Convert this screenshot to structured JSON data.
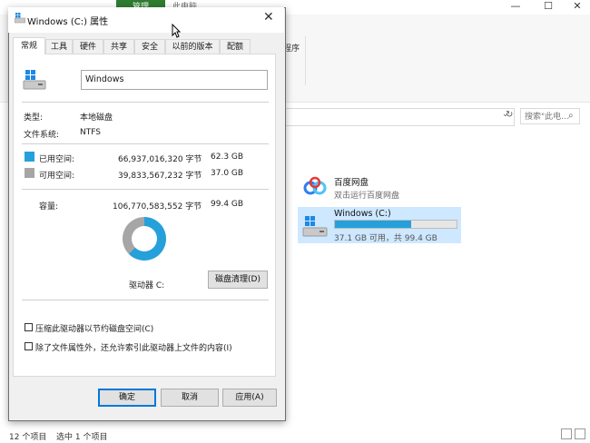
{
  "explorer": {
    "ribbon": {
      "manage_tab": "管理",
      "this_pc_tab": "此电脑",
      "group_label": "程序"
    },
    "search_placeholder": "搜索\"此电...",
    "items": [
      {
        "title": "百度网盘",
        "subtitle": "双击运行百度网盘"
      },
      {
        "title": "Windows (C:)",
        "free_text": "37.1 GB 可用，共 99.4 GB",
        "usage_fraction": 0.627
      }
    ],
    "status": {
      "count": "12 个项目",
      "selected": "选中 1 个项目"
    }
  },
  "dialog": {
    "title": "Windows (C:) 属性",
    "tabs": [
      "常规",
      "工具",
      "硬件",
      "共享",
      "安全",
      "以前的版本",
      "配额"
    ],
    "active_tab": "常规",
    "name_value": "Windows",
    "type_label": "类型:",
    "type_value": "本地磁盘",
    "fs_label": "文件系统:",
    "fs_value": "NTFS",
    "used": {
      "label": "已用空间:",
      "bytes": "66,937,016,320 字节",
      "size": "62.3 GB",
      "color": "#26a0da"
    },
    "free": {
      "label": "可用空间:",
      "bytes": "39,833,567,232 字节",
      "size": "37.0 GB",
      "color": "#a6a6a6"
    },
    "capacity": {
      "label": "容量:",
      "bytes": "106,770,583,552 字节",
      "size": "99.4 GB"
    },
    "used_fraction": 0.627,
    "drive_label": "驱动器 C:",
    "cleanup_button": "磁盘清理(D)",
    "compress_checkbox": "压缩此驱动器以节约磁盘空间(C)",
    "index_checkbox": "除了文件属性外，还允许索引此驱动器上文件的内容(I)",
    "ok_button": "确定",
    "cancel_button": "取消",
    "apply_button": "应用(A)"
  }
}
